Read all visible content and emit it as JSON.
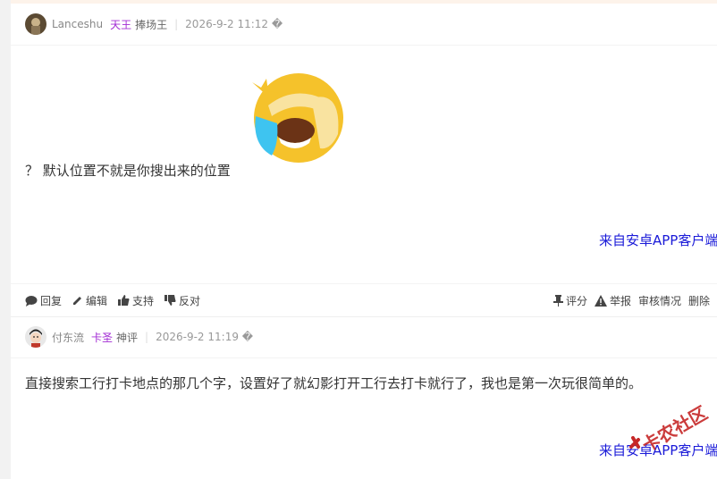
{
  "posts": [
    {
      "author": "Lanceshu",
      "group": "天王",
      "title": "捧场王",
      "time": "2026-9-2 11:12 �",
      "content": "？ 默认位置不就是你搜出来的位置",
      "from": "来自安卓APP客户端",
      "emoji": "crying-laughing-emoji"
    },
    {
      "author": "付东流",
      "group": "卡圣",
      "title": "神评",
      "time": "2026-9-2 11:19 �",
      "content": "直接搜索工行打卡地点的那几个字，设置好了就幻影打开工行去打卡就行了，我也是第一次玩很简单的。",
      "from": "来自安卓APP客户端"
    }
  ],
  "actions": {
    "reply": "回复",
    "edit": "编辑",
    "support": "支持",
    "oppose": "反对",
    "rate": "评分",
    "report": "举报",
    "review": "审核情况",
    "delete": "删除"
  },
  "watermark": "卡农社区",
  "colors": {
    "accent_link": "#1a1ad8",
    "group_purple": "#a32dd4",
    "emoji_yellow": "#f5c22b",
    "emoji_tear": "#3ec4f0"
  }
}
